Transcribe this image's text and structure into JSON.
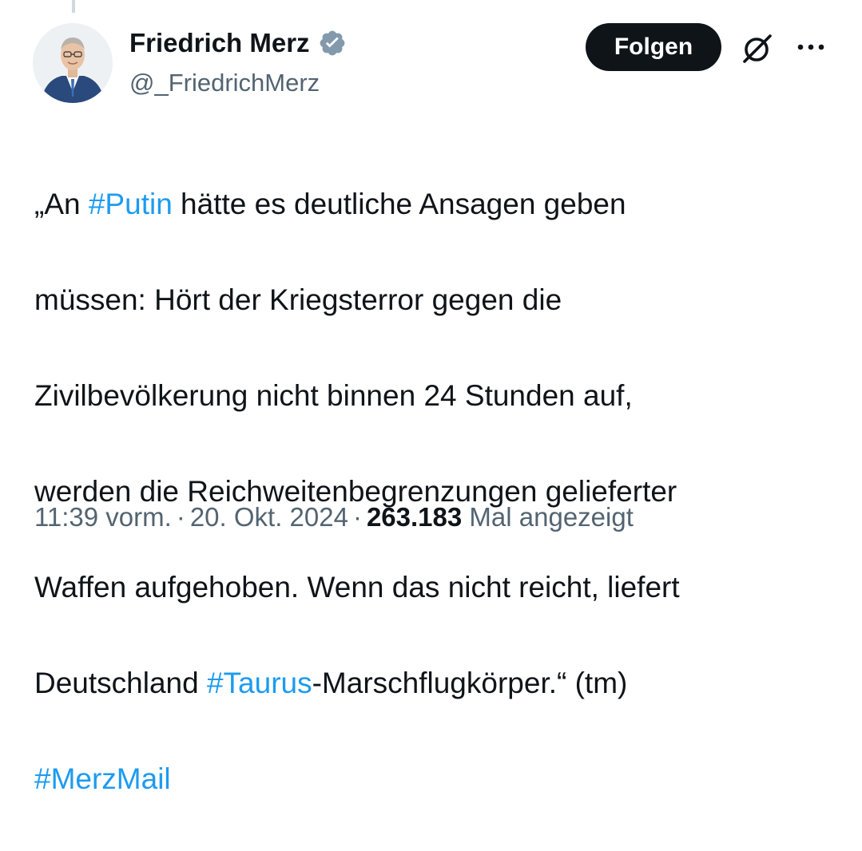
{
  "author": {
    "name": "Friedrich Merz",
    "handle": "@_FriedrichMerz",
    "verified": true,
    "verified_color": "#829aab"
  },
  "actions": {
    "follow_label": "Folgen",
    "grok_icon": "grok-slash-circle-icon",
    "more_icon": "more-dots-icon"
  },
  "tweet": {
    "lines": [
      [
        {
          "t": "„An "
        },
        {
          "t": "#Putin",
          "tag": true
        },
        {
          "t": " hätte es deutliche Ansagen geben"
        }
      ],
      [
        {
          "t": "müssen: Hört der Kriegsterror gegen die"
        }
      ],
      [
        {
          "t": "Zivilbevölkerung nicht binnen 24 Stunden auf,"
        }
      ],
      [
        {
          "t": "werden die Reichweitenbegrenzungen gelieferter"
        }
      ],
      [
        {
          "t": "Waffen aufgehoben. Wenn das nicht reicht, liefert"
        }
      ],
      [
        {
          "t": "Deutschland "
        },
        {
          "t": "#Taurus",
          "tag": true
        },
        {
          "t": "-Marschflugkörper.“ (tm)"
        }
      ],
      [
        {
          "t": "#MerzMail",
          "tag": true
        }
      ]
    ],
    "hashtag_color": "#1d9bf0"
  },
  "meta": {
    "time": "11:39 vorm.",
    "separator": "·",
    "date": "20. Okt. 2024",
    "views_count": "263.183",
    "views_label": "Mal angezeigt"
  }
}
